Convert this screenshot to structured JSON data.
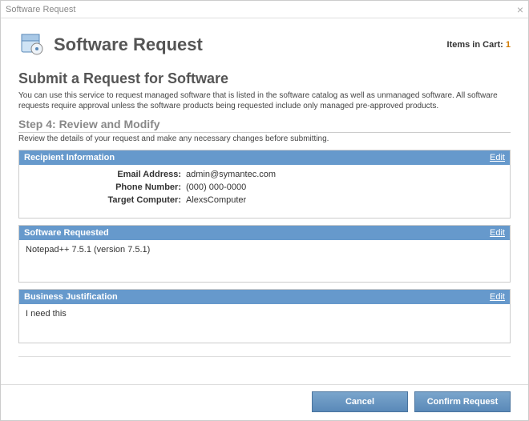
{
  "window": {
    "title": "Software Request"
  },
  "header": {
    "title": "Software Request",
    "cart_label": "Items in Cart:",
    "cart_count": "1"
  },
  "page": {
    "heading": "Submit a Request for Software",
    "description": "You can use this service to request managed software that is listed in the software catalog as well as unmanaged software. All software requests require approval unless the software products being requested include only managed pre-approved products.",
    "step_label": "Step 4: Review and Modify",
    "step_desc": "Review the details of your request and make any necessary changes before submitting."
  },
  "sections": {
    "recipient": {
      "title": "Recipient Information",
      "edit": "Edit",
      "fields": {
        "email_label": "Email Address:",
        "email_value": "admin@symantec.com",
        "phone_label": "Phone Number:",
        "phone_value": "(000) 000-0000",
        "computer_label": "Target Computer:",
        "computer_value": "AlexsComputer"
      }
    },
    "software": {
      "title": "Software Requested",
      "edit": "Edit",
      "body": "Notepad++ 7.5.1 (version 7.5.1)"
    },
    "justification": {
      "title": "Business Justification",
      "edit": "Edit",
      "body": "I need this"
    }
  },
  "buttons": {
    "cancel": "Cancel",
    "confirm": "Confirm Request"
  }
}
